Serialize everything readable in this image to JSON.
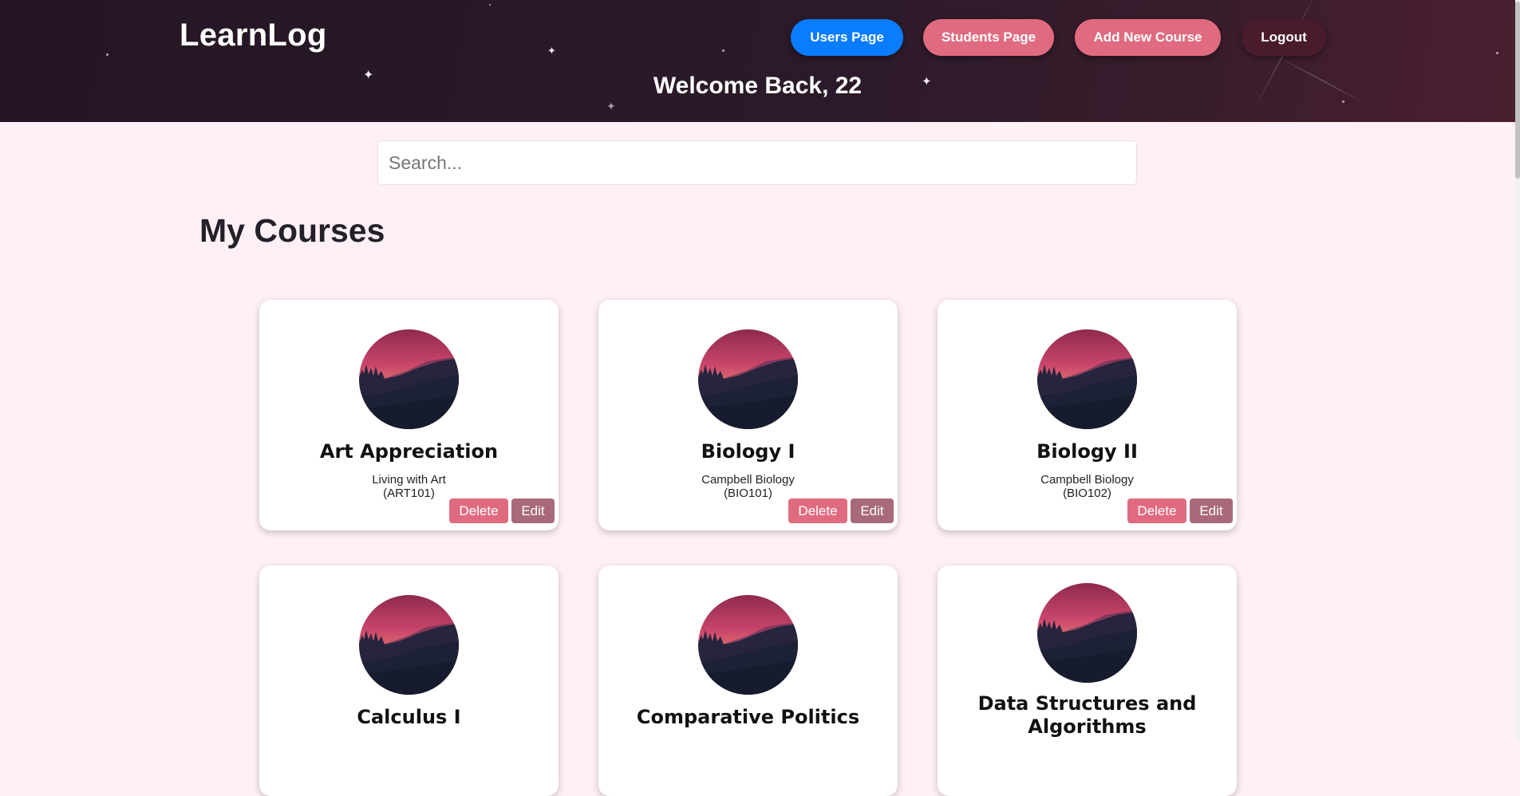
{
  "header": {
    "logo": "LearnLog",
    "welcome": "Welcome Back, 22",
    "nav": {
      "users": "Users Page",
      "students": "Students Page",
      "add_course": "Add New Course",
      "logout": "Logout"
    }
  },
  "search": {
    "placeholder": "Search..."
  },
  "section_title": "My Courses",
  "card_actions": {
    "delete": "Delete",
    "edit": "Edit"
  },
  "courses": [
    {
      "title": "Art Appreciation",
      "book": "Living with Art",
      "code": "(ART101)"
    },
    {
      "title": "Biology I",
      "book": "Campbell Biology",
      "code": "(BIO101)"
    },
    {
      "title": "Biology II",
      "book": "Campbell Biology",
      "code": "(BIO102)"
    },
    {
      "title": "Calculus I"
    },
    {
      "title": "Comparative Politics"
    },
    {
      "title": "Data Structures and Algorithms"
    }
  ],
  "colors": {
    "primary_blue": "#0a7cff",
    "accent_pink": "#e06b80",
    "edit_mauve": "#a86a7b",
    "logout_dark": "#4a1b2c",
    "page_bg": "#fff0f6"
  },
  "icons": {
    "course_image": "mountain-sunset-icon"
  }
}
